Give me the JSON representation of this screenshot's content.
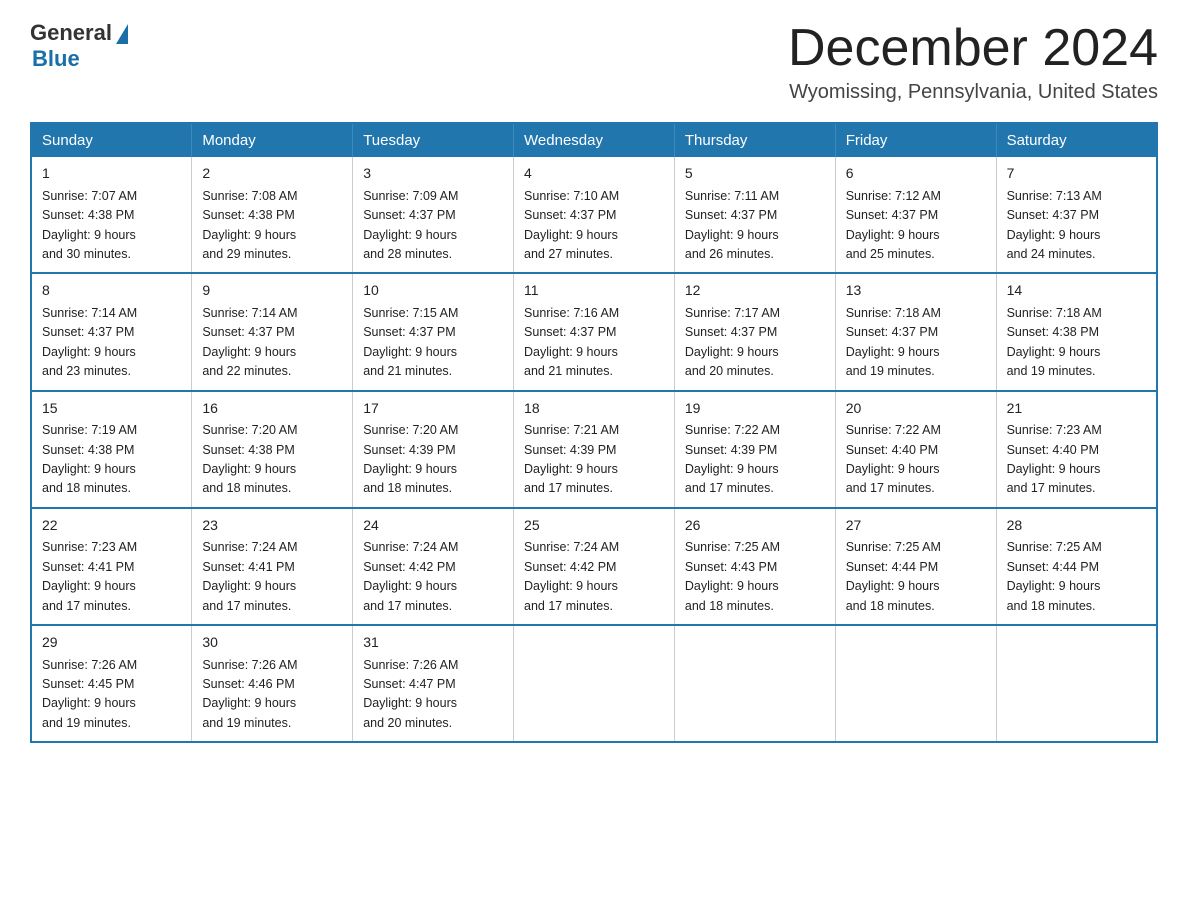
{
  "logo": {
    "general": "General",
    "blue": "Blue"
  },
  "title": {
    "month_year": "December 2024",
    "location": "Wyomissing, Pennsylvania, United States"
  },
  "headers": [
    "Sunday",
    "Monday",
    "Tuesday",
    "Wednesday",
    "Thursday",
    "Friday",
    "Saturday"
  ],
  "weeks": [
    [
      {
        "day": "1",
        "sunrise": "7:07 AM",
        "sunset": "4:38 PM",
        "daylight": "9 hours and 30 minutes."
      },
      {
        "day": "2",
        "sunrise": "7:08 AM",
        "sunset": "4:38 PM",
        "daylight": "9 hours and 29 minutes."
      },
      {
        "day": "3",
        "sunrise": "7:09 AM",
        "sunset": "4:37 PM",
        "daylight": "9 hours and 28 minutes."
      },
      {
        "day": "4",
        "sunrise": "7:10 AM",
        "sunset": "4:37 PM",
        "daylight": "9 hours and 27 minutes."
      },
      {
        "day": "5",
        "sunrise": "7:11 AM",
        "sunset": "4:37 PM",
        "daylight": "9 hours and 26 minutes."
      },
      {
        "day": "6",
        "sunrise": "7:12 AM",
        "sunset": "4:37 PM",
        "daylight": "9 hours and 25 minutes."
      },
      {
        "day": "7",
        "sunrise": "7:13 AM",
        "sunset": "4:37 PM",
        "daylight": "9 hours and 24 minutes."
      }
    ],
    [
      {
        "day": "8",
        "sunrise": "7:14 AM",
        "sunset": "4:37 PM",
        "daylight": "9 hours and 23 minutes."
      },
      {
        "day": "9",
        "sunrise": "7:14 AM",
        "sunset": "4:37 PM",
        "daylight": "9 hours and 22 minutes."
      },
      {
        "day": "10",
        "sunrise": "7:15 AM",
        "sunset": "4:37 PM",
        "daylight": "9 hours and 21 minutes."
      },
      {
        "day": "11",
        "sunrise": "7:16 AM",
        "sunset": "4:37 PM",
        "daylight": "9 hours and 21 minutes."
      },
      {
        "day": "12",
        "sunrise": "7:17 AM",
        "sunset": "4:37 PM",
        "daylight": "9 hours and 20 minutes."
      },
      {
        "day": "13",
        "sunrise": "7:18 AM",
        "sunset": "4:37 PM",
        "daylight": "9 hours and 19 minutes."
      },
      {
        "day": "14",
        "sunrise": "7:18 AM",
        "sunset": "4:38 PM",
        "daylight": "9 hours and 19 minutes."
      }
    ],
    [
      {
        "day": "15",
        "sunrise": "7:19 AM",
        "sunset": "4:38 PM",
        "daylight": "9 hours and 18 minutes."
      },
      {
        "day": "16",
        "sunrise": "7:20 AM",
        "sunset": "4:38 PM",
        "daylight": "9 hours and 18 minutes."
      },
      {
        "day": "17",
        "sunrise": "7:20 AM",
        "sunset": "4:39 PM",
        "daylight": "9 hours and 18 minutes."
      },
      {
        "day": "18",
        "sunrise": "7:21 AM",
        "sunset": "4:39 PM",
        "daylight": "9 hours and 17 minutes."
      },
      {
        "day": "19",
        "sunrise": "7:22 AM",
        "sunset": "4:39 PM",
        "daylight": "9 hours and 17 minutes."
      },
      {
        "day": "20",
        "sunrise": "7:22 AM",
        "sunset": "4:40 PM",
        "daylight": "9 hours and 17 minutes."
      },
      {
        "day": "21",
        "sunrise": "7:23 AM",
        "sunset": "4:40 PM",
        "daylight": "9 hours and 17 minutes."
      }
    ],
    [
      {
        "day": "22",
        "sunrise": "7:23 AM",
        "sunset": "4:41 PM",
        "daylight": "9 hours and 17 minutes."
      },
      {
        "day": "23",
        "sunrise": "7:24 AM",
        "sunset": "4:41 PM",
        "daylight": "9 hours and 17 minutes."
      },
      {
        "day": "24",
        "sunrise": "7:24 AM",
        "sunset": "4:42 PM",
        "daylight": "9 hours and 17 minutes."
      },
      {
        "day": "25",
        "sunrise": "7:24 AM",
        "sunset": "4:42 PM",
        "daylight": "9 hours and 17 minutes."
      },
      {
        "day": "26",
        "sunrise": "7:25 AM",
        "sunset": "4:43 PM",
        "daylight": "9 hours and 18 minutes."
      },
      {
        "day": "27",
        "sunrise": "7:25 AM",
        "sunset": "4:44 PM",
        "daylight": "9 hours and 18 minutes."
      },
      {
        "day": "28",
        "sunrise": "7:25 AM",
        "sunset": "4:44 PM",
        "daylight": "9 hours and 18 minutes."
      }
    ],
    [
      {
        "day": "29",
        "sunrise": "7:26 AM",
        "sunset": "4:45 PM",
        "daylight": "9 hours and 19 minutes."
      },
      {
        "day": "30",
        "sunrise": "7:26 AM",
        "sunset": "4:46 PM",
        "daylight": "9 hours and 19 minutes."
      },
      {
        "day": "31",
        "sunrise": "7:26 AM",
        "sunset": "4:47 PM",
        "daylight": "9 hours and 20 minutes."
      },
      null,
      null,
      null,
      null
    ]
  ],
  "labels": {
    "sunrise": "Sunrise:",
    "sunset": "Sunset:",
    "daylight": "Daylight:"
  }
}
